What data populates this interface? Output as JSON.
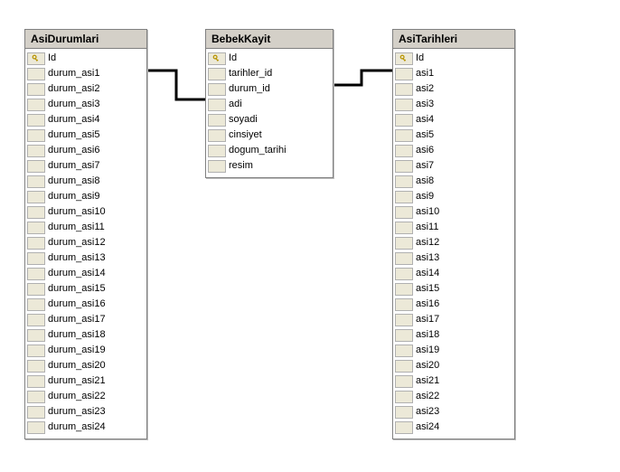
{
  "tables": [
    {
      "name": "AsiDurumlari",
      "fields": [
        {
          "name": "Id",
          "pk": true
        },
        {
          "name": "durum_asi1",
          "pk": false
        },
        {
          "name": "durum_asi2",
          "pk": false
        },
        {
          "name": "durum_asi3",
          "pk": false
        },
        {
          "name": "durum_asi4",
          "pk": false
        },
        {
          "name": "durum_asi5",
          "pk": false
        },
        {
          "name": "durum_asi6",
          "pk": false
        },
        {
          "name": "durum_asi7",
          "pk": false
        },
        {
          "name": "durum_asi8",
          "pk": false
        },
        {
          "name": "durum_asi9",
          "pk": false
        },
        {
          "name": "durum_asi10",
          "pk": false
        },
        {
          "name": "durum_asi11",
          "pk": false
        },
        {
          "name": "durum_asi12",
          "pk": false
        },
        {
          "name": "durum_asi13",
          "pk": false
        },
        {
          "name": "durum_asi14",
          "pk": false
        },
        {
          "name": "durum_asi15",
          "pk": false
        },
        {
          "name": "durum_asi16",
          "pk": false
        },
        {
          "name": "durum_asi17",
          "pk": false
        },
        {
          "name": "durum_asi18",
          "pk": false
        },
        {
          "name": "durum_asi19",
          "pk": false
        },
        {
          "name": "durum_asi20",
          "pk": false
        },
        {
          "name": "durum_asi21",
          "pk": false
        },
        {
          "name": "durum_asi22",
          "pk": false
        },
        {
          "name": "durum_asi23",
          "pk": false
        },
        {
          "name": "durum_asi24",
          "pk": false
        }
      ]
    },
    {
      "name": "BebekKayit",
      "fields": [
        {
          "name": "Id",
          "pk": true
        },
        {
          "name": "tarihler_id",
          "pk": false
        },
        {
          "name": "durum_id",
          "pk": false
        },
        {
          "name": "adi",
          "pk": false
        },
        {
          "name": "soyadi",
          "pk": false
        },
        {
          "name": "cinsiyet",
          "pk": false
        },
        {
          "name": "dogum_tarihi",
          "pk": false
        },
        {
          "name": "resim",
          "pk": false
        }
      ]
    },
    {
      "name": "AsiTarihleri",
      "fields": [
        {
          "name": "Id",
          "pk": true
        },
        {
          "name": "asi1",
          "pk": false
        },
        {
          "name": "asi2",
          "pk": false
        },
        {
          "name": "asi3",
          "pk": false
        },
        {
          "name": "asi4",
          "pk": false
        },
        {
          "name": "asi5",
          "pk": false
        },
        {
          "name": "asi6",
          "pk": false
        },
        {
          "name": "asi7",
          "pk": false
        },
        {
          "name": "asi8",
          "pk": false
        },
        {
          "name": "asi9",
          "pk": false
        },
        {
          "name": "asi10",
          "pk": false
        },
        {
          "name": "asi11",
          "pk": false
        },
        {
          "name": "asi12",
          "pk": false
        },
        {
          "name": "asi13",
          "pk": false
        },
        {
          "name": "asi14",
          "pk": false
        },
        {
          "name": "asi15",
          "pk": false
        },
        {
          "name": "asi16",
          "pk": false
        },
        {
          "name": "asi17",
          "pk": false
        },
        {
          "name": "asi18",
          "pk": false
        },
        {
          "name": "asi19",
          "pk": false
        },
        {
          "name": "asi20",
          "pk": false
        },
        {
          "name": "asi21",
          "pk": false
        },
        {
          "name": "asi22",
          "pk": false
        },
        {
          "name": "asi23",
          "pk": false
        },
        {
          "name": "asi24",
          "pk": false
        }
      ]
    }
  ],
  "relationships": [
    {
      "from_table": "AsiDurumlari",
      "from_field": "Id",
      "to_table": "BebekKayit",
      "to_field": "durum_id"
    },
    {
      "from_table": "AsiTarihleri",
      "from_field": "Id",
      "to_table": "BebekKayit",
      "to_field": "tarihler_id"
    }
  ],
  "colors": {
    "header_bg": "#d4d0c8",
    "cell_bg": "#ece9d8",
    "border": "#808080",
    "key_color": "#e6c200"
  }
}
